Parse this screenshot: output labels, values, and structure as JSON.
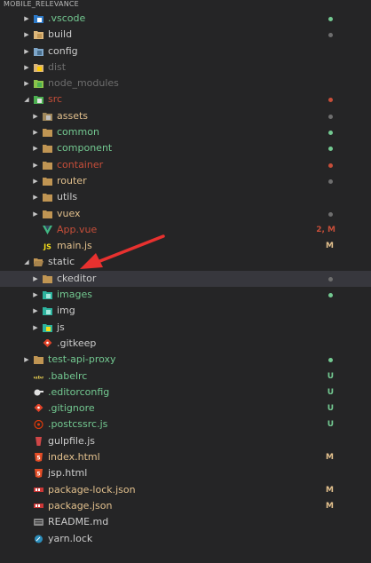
{
  "explorer": {
    "title": "MOBILE_RELEVANCE"
  },
  "colors": {
    "added": "#73c991",
    "modified": "#e2c08d",
    "deleted": "#c74e39",
    "muted": "#6e6e6e",
    "error": "#f14c4c",
    "default": "#cccccc"
  },
  "tree": [
    {
      "label": ".vscode",
      "depth": 0,
      "type": "folder",
      "expanded": false,
      "icon": "vscode-folder-icon",
      "labelColor": "added",
      "dot": "added"
    },
    {
      "label": "build",
      "depth": 0,
      "type": "folder",
      "expanded": false,
      "icon": "build-folder-icon",
      "labelColor": "default",
      "dot": "muted"
    },
    {
      "label": "config",
      "depth": 0,
      "type": "folder",
      "expanded": false,
      "icon": "config-folder-icon",
      "labelColor": "default",
      "dot": null
    },
    {
      "label": "dist",
      "depth": 0,
      "type": "folder",
      "expanded": false,
      "icon": "dist-folder-icon",
      "labelColor": "muted",
      "dot": null
    },
    {
      "label": "node_modules",
      "depth": 0,
      "type": "folder",
      "expanded": false,
      "icon": "node-modules-folder-icon",
      "labelColor": "muted",
      "dot": null
    },
    {
      "label": "src",
      "depth": 0,
      "type": "folder",
      "expanded": true,
      "icon": "src-folder-icon",
      "labelColor": "deleted",
      "dot": "deleted"
    },
    {
      "label": "assets",
      "depth": 1,
      "type": "folder",
      "expanded": false,
      "icon": "assets-folder-icon",
      "labelColor": "modified",
      "dot": "muted"
    },
    {
      "label": "common",
      "depth": 1,
      "type": "folder",
      "expanded": false,
      "icon": "folder-icon",
      "labelColor": "added",
      "dot": "added"
    },
    {
      "label": "component",
      "depth": 1,
      "type": "folder",
      "expanded": false,
      "icon": "folder-icon",
      "labelColor": "added",
      "dot": "added"
    },
    {
      "label": "container",
      "depth": 1,
      "type": "folder",
      "expanded": false,
      "icon": "folder-icon",
      "labelColor": "deleted",
      "dot": "deleted"
    },
    {
      "label": "router",
      "depth": 1,
      "type": "folder",
      "expanded": false,
      "icon": "folder-icon",
      "labelColor": "modified",
      "dot": "muted"
    },
    {
      "label": "utils",
      "depth": 1,
      "type": "folder",
      "expanded": false,
      "icon": "folder-icon",
      "labelColor": "default",
      "dot": null
    },
    {
      "label": "vuex",
      "depth": 1,
      "type": "folder",
      "expanded": false,
      "icon": "folder-icon",
      "labelColor": "modified",
      "dot": "muted"
    },
    {
      "label": "App.vue",
      "depth": 1,
      "type": "file",
      "icon": "vue-file-icon",
      "labelColor": "deleted",
      "status": "2, M",
      "statusColor": "deleted"
    },
    {
      "label": "main.js",
      "depth": 1,
      "type": "file",
      "icon": "js-file-icon",
      "labelColor": "modified",
      "status": "M",
      "statusColor": "modified"
    },
    {
      "label": "static",
      "depth": 0,
      "type": "folder",
      "expanded": true,
      "icon": "folder-open-icon",
      "labelColor": "default",
      "dot": null
    },
    {
      "label": "ckeditor",
      "depth": 1,
      "type": "folder",
      "expanded": false,
      "icon": "folder-icon",
      "labelColor": "default",
      "dot": "muted",
      "selected": true
    },
    {
      "label": "images",
      "depth": 1,
      "type": "folder",
      "expanded": false,
      "icon": "images-folder-icon",
      "labelColor": "added",
      "dot": "added"
    },
    {
      "label": "img",
      "depth": 1,
      "type": "folder",
      "expanded": false,
      "icon": "images-folder-icon",
      "labelColor": "default",
      "dot": null
    },
    {
      "label": "js",
      "depth": 1,
      "type": "folder",
      "expanded": false,
      "icon": "js-folder-icon",
      "labelColor": "default",
      "dot": null
    },
    {
      "label": ".gitkeep",
      "depth": 1,
      "type": "file",
      "icon": "git-file-icon",
      "labelColor": "default"
    },
    {
      "label": "test-api-proxy",
      "depth": 0,
      "type": "folder",
      "expanded": false,
      "icon": "folder-icon",
      "labelColor": "added",
      "dot": "added"
    },
    {
      "label": ".babelrc",
      "depth": 0,
      "type": "file",
      "icon": "babel-file-icon",
      "labelColor": "added",
      "status": "U",
      "statusColor": "added"
    },
    {
      "label": ".editorconfig",
      "depth": 0,
      "type": "file",
      "icon": "editorconfig-file-icon",
      "labelColor": "added",
      "status": "U",
      "statusColor": "added"
    },
    {
      "label": ".gitignore",
      "depth": 0,
      "type": "file",
      "icon": "git-file-icon",
      "labelColor": "added",
      "status": "U",
      "statusColor": "added"
    },
    {
      "label": ".postcssrc.js",
      "depth": 0,
      "type": "file",
      "icon": "postcss-file-icon",
      "labelColor": "added",
      "status": "U",
      "statusColor": "added"
    },
    {
      "label": "gulpfile.js",
      "depth": 0,
      "type": "file",
      "icon": "gulp-file-icon",
      "labelColor": "default"
    },
    {
      "label": "index.html",
      "depth": 0,
      "type": "file",
      "icon": "html-file-icon",
      "labelColor": "modified",
      "status": "M",
      "statusColor": "modified"
    },
    {
      "label": "jsp.html",
      "depth": 0,
      "type": "file",
      "icon": "html-file-icon",
      "labelColor": "default"
    },
    {
      "label": "package-lock.json",
      "depth": 0,
      "type": "file",
      "icon": "npm-file-icon",
      "labelColor": "modified",
      "status": "M",
      "statusColor": "modified"
    },
    {
      "label": "package.json",
      "depth": 0,
      "type": "file",
      "icon": "npm-file-icon",
      "labelColor": "modified",
      "status": "M",
      "statusColor": "modified"
    },
    {
      "label": "README.md",
      "depth": 0,
      "type": "file",
      "icon": "readme-file-icon",
      "labelColor": "default"
    },
    {
      "label": "yarn.lock",
      "depth": 0,
      "type": "file",
      "icon": "yarn-file-icon",
      "labelColor": "default"
    }
  ],
  "annotation": {
    "icon": "red-arrow-icon",
    "color": "#e8312f"
  }
}
